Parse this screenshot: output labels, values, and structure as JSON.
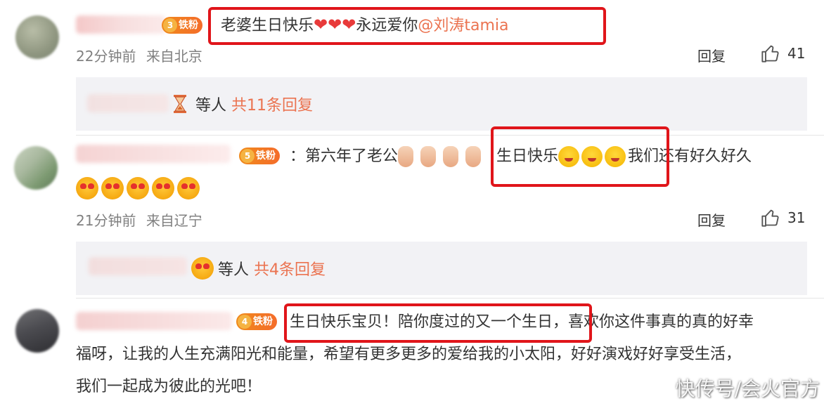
{
  "comments": [
    {
      "badge": "铁粉",
      "text_before": "老婆生日快乐",
      "hearts": "❤❤❤",
      "text_after": "永远爱你",
      "mention": "@刘涛tamia",
      "time": "22分钟前",
      "location": "来自北京",
      "reply_label": "回复",
      "likes": "41",
      "replies_summary": {
        "prefix": "等人",
        "count_text": "共11条回复"
      }
    },
    {
      "badge": "铁粉",
      "text_part1": "：第六年了老公",
      "text_highlight": "生日快乐",
      "text_part2": "我们还有好久好久",
      "time": "21分钟前",
      "location": "来自辽宁",
      "reply_label": "回复",
      "likes": "31",
      "replies_summary": {
        "prefix": "等人",
        "count_text": "共4条回复"
      }
    },
    {
      "badge": "铁粉",
      "line1_highlight": "生日快乐宝贝！陪你度过的又一个生日，",
      "line1_rest": "喜欢你这件事真的真的好幸",
      "line2": "福呀，让我的人生充满阳光和能量，希望有更多更多的爱给我的小太阳，好好演戏好好享受生活，",
      "line3": "我们一起成为彼此的光吧！"
    }
  ],
  "watermark": "快传号/会火官方",
  "colors": {
    "highlight_box": "#e0151a",
    "mention": "#eb7350",
    "reply_bg": "#f2f2f5",
    "meta": "#808080"
  },
  "icons": [
    "thumbs-up-icon",
    "hourglass-icon",
    "heart-emoji",
    "kiss-emoji",
    "heart-eyes-emoji",
    "clap-hand-emoji",
    "level-badge-icon"
  ]
}
